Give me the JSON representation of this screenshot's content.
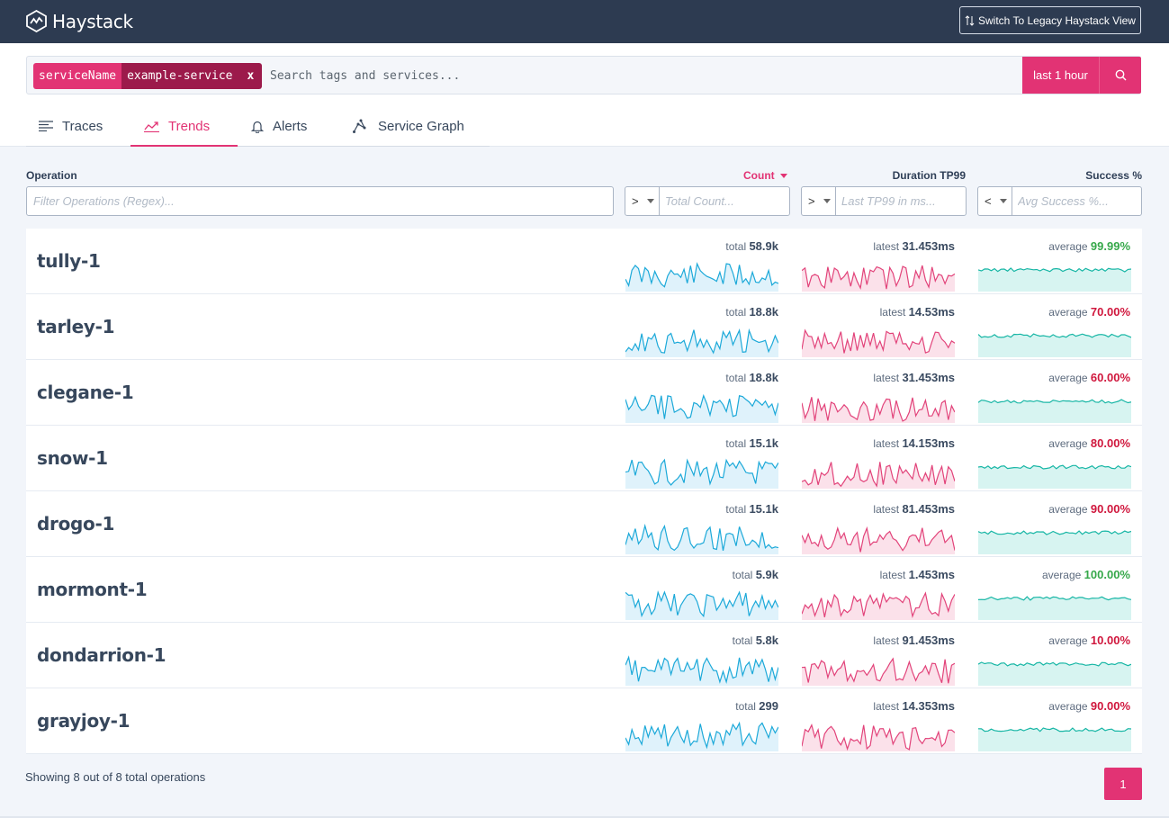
{
  "app": {
    "name": "Haystack",
    "legacy_button": "Switch To Legacy Haystack View"
  },
  "search": {
    "chip_key": "serviceName",
    "chip_value": "example-service",
    "chip_remove": "x",
    "placeholder": "Search tags and services...",
    "time_range": "last 1 hour"
  },
  "tabs": [
    {
      "label": "Traces",
      "icon": "list-icon"
    },
    {
      "label": "Trends",
      "icon": "trend-line-icon",
      "active": true
    },
    {
      "label": "Alerts",
      "icon": "bell-icon"
    },
    {
      "label": "Service Graph",
      "icon": "graph-icon"
    }
  ],
  "filters": {
    "operation_label": "Operation",
    "operation_placeholder": "Filter Operations (Regex)...",
    "count_label": "Count",
    "count_operator": ">",
    "count_placeholder": "Total Count...",
    "duration_label": "Duration TP99",
    "duration_operator": ">",
    "duration_placeholder": "Last TP99 in ms...",
    "success_label": "Success %",
    "success_operator": "<",
    "success_placeholder": "Avg Success %..."
  },
  "labels": {
    "total": "total",
    "latest": "latest",
    "average": "average"
  },
  "operations": [
    {
      "name": "tully-1",
      "total": "58.9k",
      "latest": "31.453ms",
      "average": "99.99%",
      "average_status": "good"
    },
    {
      "name": "tarley-1",
      "total": "18.8k",
      "latest": "14.53ms",
      "average": "70.00%",
      "average_status": "bad"
    },
    {
      "name": "clegane-1",
      "total": "18.8k",
      "latest": "31.453ms",
      "average": "60.00%",
      "average_status": "bad"
    },
    {
      "name": "snow-1",
      "total": "15.1k",
      "latest": "14.153ms",
      "average": "80.00%",
      "average_status": "bad"
    },
    {
      "name": "drogo-1",
      "total": "15.1k",
      "latest": "81.453ms",
      "average": "90.00%",
      "average_status": "bad"
    },
    {
      "name": "mormont-1",
      "total": "5.9k",
      "latest": "1.453ms",
      "average": "100.00%",
      "average_status": "good"
    },
    {
      "name": "dondarrion-1",
      "total": "5.8k",
      "latest": "91.453ms",
      "average": "10.00%",
      "average_status": "bad"
    },
    {
      "name": "grayjoy-1",
      "total": "299",
      "latest": "14.353ms",
      "average": "90.00%",
      "average_status": "bad"
    }
  ],
  "footer": {
    "summary": "Showing 8 out of 8 total operations",
    "page": "1"
  },
  "colors": {
    "accent": "#e23374",
    "header_bg": "#2d3b51",
    "count_line": "#1ca9d9",
    "count_fill": "#dff2fb",
    "duration_line": "#e2437a",
    "duration_fill": "#fbe1ea",
    "success_line": "#17b6a5",
    "success_fill": "#d7f4f1",
    "good": "#36a84a",
    "bad": "#d0173d"
  }
}
